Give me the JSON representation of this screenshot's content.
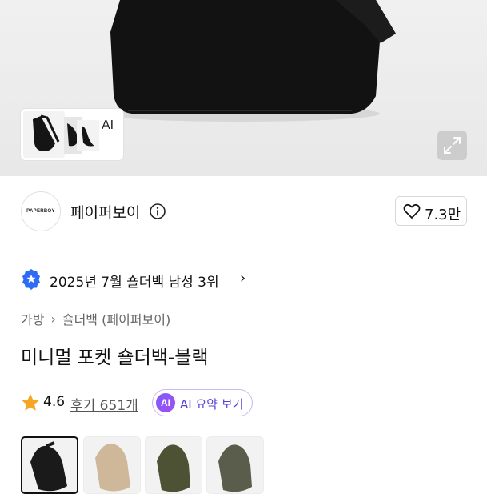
{
  "hero": {
    "thumbnail_label": "AI",
    "thumbnail_chevron": "›",
    "expand_icon": "expand-icon",
    "colors": {
      "background": "#ededed",
      "bag": "#111111"
    }
  },
  "brand": {
    "logo_text": "PAPERBOY",
    "name": "페이퍼보이",
    "info_icon": "info-icon",
    "like_icon": "heart-outline-icon",
    "like_count": "7.3만"
  },
  "ranking": {
    "badge_icon": "ranking-badge-icon",
    "text": "2025년 7월 숄더백 남성 3위",
    "chevron": "›",
    "badge_color": "#2f6cf6"
  },
  "breadcrumb": [
    {
      "label": "가방"
    },
    {
      "label": "숄더백 (페이퍼보이)"
    }
  ],
  "breadcrumb_separator": "›",
  "product": {
    "title": "미니멀 포켓 숄더백-블랙"
  },
  "rating": {
    "star_icon": "star-icon",
    "score": "4.6",
    "reviews": "후기 651개",
    "ai_badge": "AI",
    "ai_summary_label": "AI 요약 보기",
    "star_color": "#f5a623"
  },
  "swatches": [
    {
      "name": "black",
      "color": "#1a1a1a",
      "selected": true
    },
    {
      "name": "beige",
      "color": "#cfb89a",
      "selected": false
    },
    {
      "name": "khaki",
      "color": "#4d5234",
      "selected": false
    },
    {
      "name": "olive-gray",
      "color": "#5a5c4c",
      "selected": false
    }
  ]
}
